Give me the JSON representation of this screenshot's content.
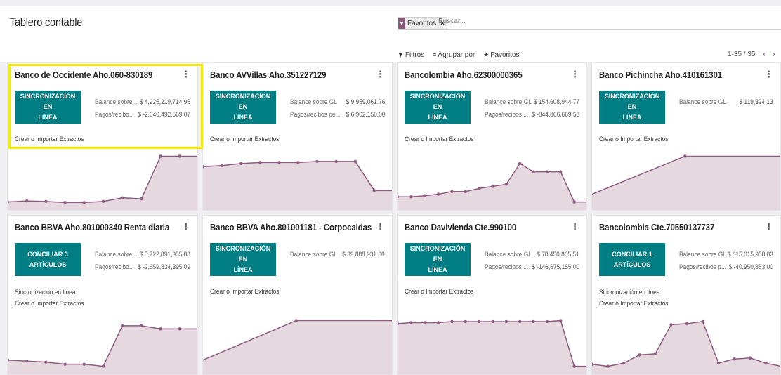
{
  "header": {
    "title": "Tablero contable",
    "search": {
      "facet_label": "Favoritos",
      "facet_remove": "×",
      "facet_icon": "filter-icon",
      "placeholder": "Buscar..."
    },
    "menus": {
      "filters": "Filtros",
      "group_by": "Agrupar por",
      "favorites": "Favoritos"
    },
    "pager": {
      "value": "1-35 / 35",
      "prev": "‹",
      "next": "›"
    }
  },
  "colors": {
    "accent": "#875a7b",
    "button": "#017e84",
    "highlight": "#f5e90f",
    "sparkline_fill": "#e5d9df",
    "sparkline_line": "#8e5b82"
  },
  "cards": [
    {
      "title": "Banco de Occidente Aho.060-830189",
      "button": [
        "SINCRONIZACIÓN EN",
        "LÍNEA"
      ],
      "stats": [
        {
          "label": "Balance sobre...",
          "value": "$ 4,925,219,714.95"
        },
        {
          "label": "Pagos/recibo...",
          "value": "$ -2,040,492,569.07"
        }
      ],
      "links": [
        "Crear o Importar Extractos"
      ],
      "spark": [
        0.1,
        0.12,
        0.11,
        0.09,
        0.09,
        0.11,
        0.18,
        0.16,
        0.98,
        0.98,
        0.98
      ],
      "highlighted": true
    },
    {
      "title": "Banco AVVillas Aho.351227129",
      "button": [
        "SINCRONIZACIÓN EN",
        "LÍNEA"
      ],
      "stats": [
        {
          "label": "Balance sobre GL",
          "value": "$ 9,959,061.76"
        },
        {
          "label": "Pagos/recibos pe...",
          "value": "$ 6,902,150.00"
        }
      ],
      "links": [
        "Crear o Importar Extractos"
      ],
      "spark": [
        0.78,
        0.8,
        0.84,
        0.86,
        0.86,
        0.86,
        0.88,
        0.88,
        0.88,
        0.32,
        0.32
      ]
    },
    {
      "title": "Bancolombia Aho.62300000365",
      "button": [
        "SINCRONIZACIÓN EN",
        "LÍNEA"
      ],
      "stats": [
        {
          "label": "Balance sobre GL",
          "value": "$ 154,608,944.77"
        },
        {
          "label": "Pagos/recibos ...",
          "value": "$ -844,866,669.58"
        }
      ],
      "links": [
        "Crear o Importar Extractos"
      ],
      "spark": [
        0.2,
        0.2,
        0.22,
        0.25,
        0.3,
        0.3,
        0.36,
        0.4,
        0.44,
        0.84,
        0.68,
        0.68,
        0.68,
        0.1,
        0.1
      ]
    },
    {
      "title": "Banco Pichincha Aho.410161301",
      "button": [
        "SINCRONIZACIÓN EN",
        "LÍNEA"
      ],
      "stats": [
        {
          "label": "Balance sobre GL",
          "value": "$ 119,324.13"
        }
      ],
      "links": [
        "Crear o Importar Extractos"
      ],
      "spark": [
        0.25,
        0.98,
        0.98
      ]
    },
    {
      "title": "Banco BBVA Aho.801000340 Renta diaria",
      "button": [
        "CONCILIAR 3",
        "ARTÍCULOS"
      ],
      "stats": [
        {
          "label": "Balance sobre...",
          "value": "$ 5,722,891,355.88"
        },
        {
          "label": "Pagos/recibo...",
          "value": "$ -2,659,834,395.09"
        }
      ],
      "links": [
        "Sincronización en línea",
        "Crear o Importar Extractos"
      ],
      "spark": [
        0.22,
        0.2,
        0.18,
        0.14,
        0.14,
        0.1,
        0.88,
        0.88,
        0.82,
        0.82,
        0.82
      ]
    },
    {
      "title": "Banco BBVA Aho.801001181 - Corpocaldas",
      "button": [
        "SINCRONIZACIÓN EN",
        "LÍNEA"
      ],
      "stats": [
        {
          "label": "Balance sobre GL",
          "value": "$ 39,888,931.00"
        }
      ],
      "links": [
        "Crear o Importar Extractos"
      ],
      "spark": [
        0.22,
        0.98,
        0.98
      ]
    },
    {
      "title": "Banco Davivienda Cte.990100",
      "button": [
        "SINCRONIZACIÓN EN",
        "LÍNEA"
      ],
      "stats": [
        {
          "label": "Balance sobre GL",
          "value": "$ 78,450,865.51"
        },
        {
          "label": "Pagos/recibos ...",
          "value": "$ -146,675,155.00"
        }
      ],
      "links": [
        "Crear o Importar Extractos"
      ],
      "spark": [
        0.92,
        0.94,
        0.94,
        0.94,
        0.96,
        0.96,
        0.96,
        0.96,
        0.96,
        0.96,
        0.96,
        0.96,
        0.98,
        0.1,
        0.1
      ]
    },
    {
      "title": "Bancolombia Cte.70550137737",
      "button": [
        "CONCILIAR 1",
        "ARTÍCULOS"
      ],
      "stats": [
        {
          "label": "Balance sobre GL",
          "value": "$ 815,015,958.03"
        },
        {
          "label": "Pagos/recibos p...",
          "value": "$ -40,950,853.00"
        }
      ],
      "links": [
        "Sincronización en línea",
        "Crear o Importar Extractos"
      ],
      "spark": [
        0.14,
        0.1,
        0.16,
        0.32,
        0.34,
        0.9,
        0.92,
        0.96,
        0.16,
        0.24,
        0.26,
        0.16,
        0.1
      ]
    }
  ]
}
